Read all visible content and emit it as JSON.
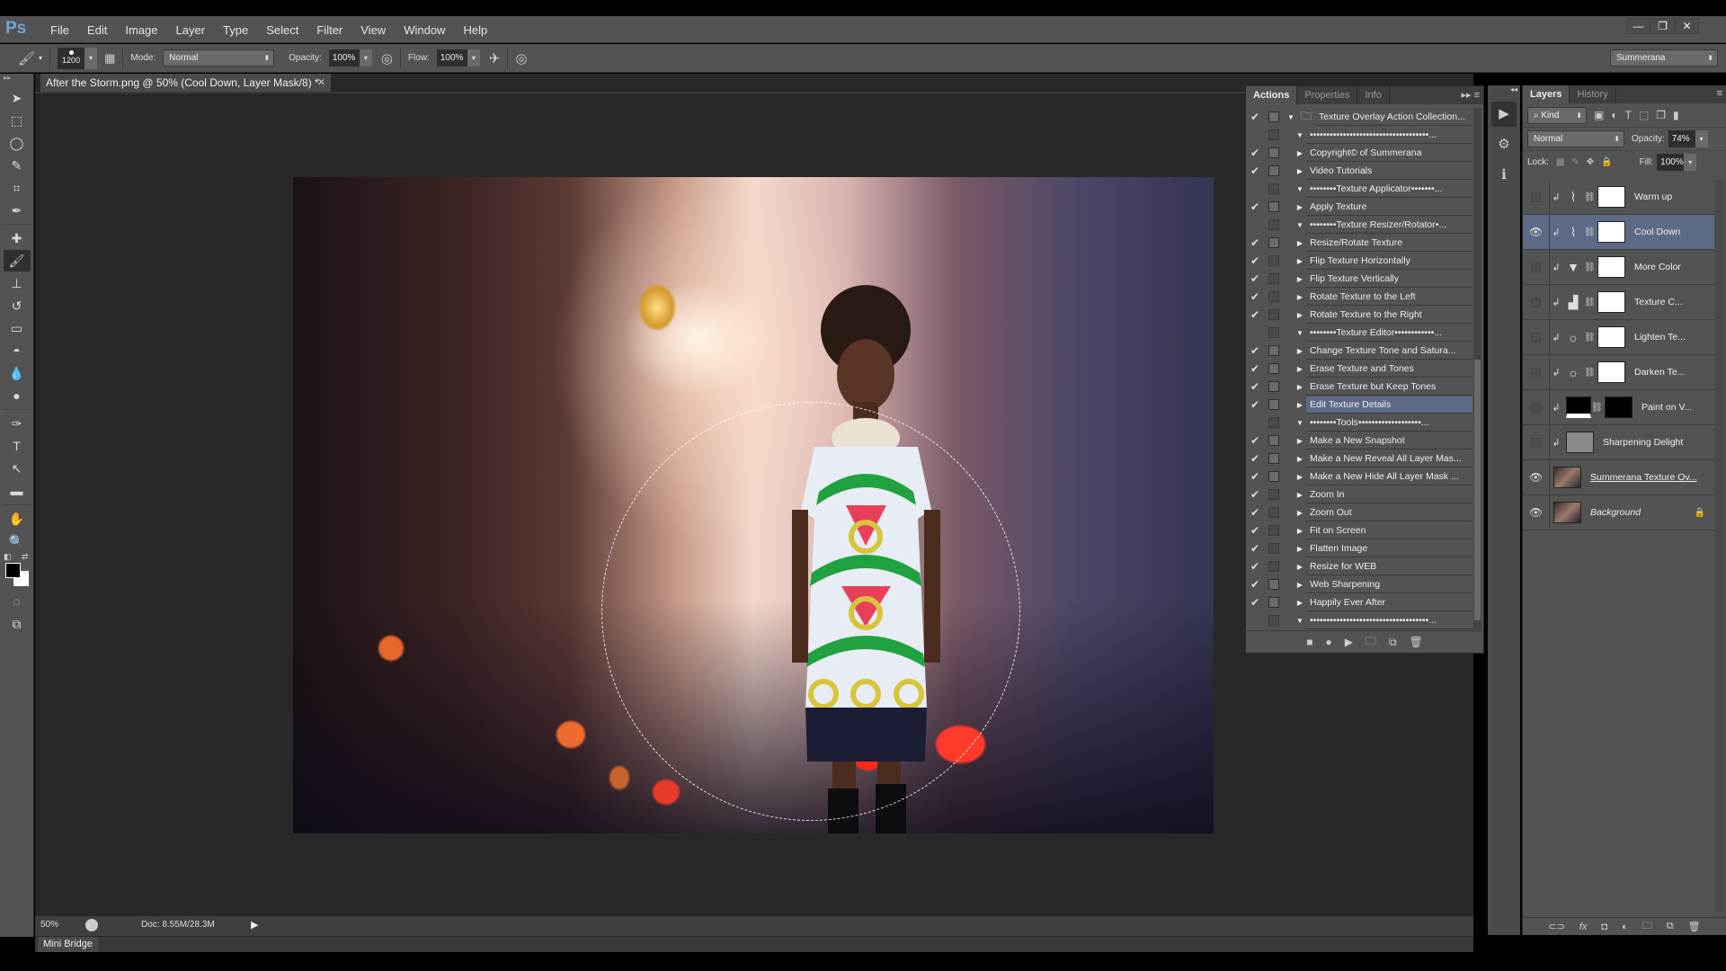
{
  "app": {
    "logo": "Ps"
  },
  "menu": [
    "File",
    "Edit",
    "Image",
    "Layer",
    "Type",
    "Select",
    "Filter",
    "View",
    "Window",
    "Help"
  ],
  "window_controls": {
    "minimize": "—",
    "restore": "❐",
    "close": "✕"
  },
  "options_bar": {
    "brush_size": "1200",
    "mode_label": "Mode:",
    "mode_value": "Normal",
    "opacity_label": "Opacity:",
    "opacity_value": "100%",
    "flow_label": "Flow:",
    "flow_value": "100%",
    "workspace": "Summerana"
  },
  "document": {
    "tab_title": "After the Storm.png @ 50% (Cool Down, Layer Mask/8) *",
    "zoom": "50%",
    "doc_info": "Doc: 8.55M/28.3M"
  },
  "bottom_panel": {
    "mini_bridge": "Mini Bridge"
  },
  "actions_panel": {
    "tabs": [
      "Actions",
      "Properties",
      "Info"
    ],
    "active_tab": "Actions",
    "items": [
      {
        "label": "Texture Overlay Action Collection...",
        "checked": true,
        "dialog": true,
        "expanded": true,
        "level": 0,
        "folder": true
      },
      {
        "label": "••••••••••••••••••••••••••••••••••••...",
        "checked": false,
        "dialog": false,
        "expanded": true,
        "level": 1
      },
      {
        "label": "Copyright© of Summerana",
        "checked": true,
        "dialog": true,
        "expanded": false,
        "level": 1
      },
      {
        "label": "Video Tutorials",
        "checked": true,
        "dialog": true,
        "expanded": false,
        "level": 1
      },
      {
        "label": "••••••••Texture Applicator•••••••...",
        "checked": false,
        "dialog": false,
        "expanded": true,
        "level": 1
      },
      {
        "label": "Apply Texture",
        "checked": true,
        "dialog": true,
        "expanded": false,
        "level": 1
      },
      {
        "label": "••••••••Texture Resizer/Rotator•...",
        "checked": false,
        "dialog": false,
        "expanded": true,
        "level": 1
      },
      {
        "label": "Resize/Rotate Texture",
        "checked": true,
        "dialog": true,
        "expanded": false,
        "level": 1
      },
      {
        "label": "Flip Texture  Horizontally",
        "checked": true,
        "dialog": false,
        "expanded": false,
        "level": 1
      },
      {
        "label": "Flip Texture Vertically",
        "checked": true,
        "dialog": false,
        "expanded": false,
        "level": 1
      },
      {
        "label": "Rotate Texture to the Left",
        "checked": true,
        "dialog": false,
        "expanded": false,
        "level": 1
      },
      {
        "label": "Rotate Texture to the Right",
        "checked": true,
        "dialog": false,
        "expanded": false,
        "level": 1
      },
      {
        "label": "••••••••Texture Editor••••••••••••...",
        "checked": false,
        "dialog": false,
        "expanded": true,
        "level": 1
      },
      {
        "label": "Change Texture Tone and Satura...",
        "checked": true,
        "dialog": true,
        "expanded": false,
        "level": 1
      },
      {
        "label": "Erase Texture and Tones",
        "checked": true,
        "dialog": true,
        "expanded": false,
        "level": 1
      },
      {
        "label": "Erase Texture but Keep Tones",
        "checked": true,
        "dialog": true,
        "expanded": false,
        "level": 1
      },
      {
        "label": "Edit Texture Details",
        "checked": true,
        "dialog": true,
        "expanded": false,
        "level": 1,
        "selected": true
      },
      {
        "label": "••••••••Tools•••••••••••••••••••...",
        "checked": false,
        "dialog": false,
        "expanded": true,
        "level": 1
      },
      {
        "label": "Make a New Snapshot",
        "checked": true,
        "dialog": true,
        "expanded": false,
        "level": 1
      },
      {
        "label": "Make a New Reveal All Layer Mas...",
        "checked": true,
        "dialog": true,
        "expanded": false,
        "level": 1
      },
      {
        "label": "Make a New Hide All Layer Mask ...",
        "checked": true,
        "dialog": true,
        "expanded": false,
        "level": 1
      },
      {
        "label": "Zoom In",
        "checked": true,
        "dialog": false,
        "expanded": false,
        "level": 1
      },
      {
        "label": "Zoom Out",
        "checked": true,
        "dialog": false,
        "expanded": false,
        "level": 1
      },
      {
        "label": "Fit on Screen",
        "checked": true,
        "dialog": false,
        "expanded": false,
        "level": 1
      },
      {
        "label": "Flatten Image",
        "checked": true,
        "dialog": false,
        "expanded": false,
        "level": 1
      },
      {
        "label": "Resize for WEB",
        "checked": true,
        "dialog": false,
        "expanded": false,
        "level": 1
      },
      {
        "label": "Web Sharpening",
        "checked": true,
        "dialog": true,
        "expanded": false,
        "level": 1
      },
      {
        "label": "Happily Ever After",
        "checked": true,
        "dialog": true,
        "expanded": false,
        "level": 1
      },
      {
        "label": "••••••••••••••••••••••••••••••••••••...",
        "checked": false,
        "dialog": false,
        "expanded": true,
        "level": 1
      }
    ],
    "bottom_buttons": [
      "stop",
      "record",
      "play",
      "new-set",
      "new-action",
      "delete"
    ]
  },
  "layers_panel": {
    "tabs": [
      "Layers",
      "History"
    ],
    "active_tab": "Layers",
    "filter": "Kind",
    "blend_mode": "Normal",
    "opacity_label": "Opacity:",
    "opacity_value": "74%",
    "lock_label": "Lock:",
    "fill_label": "Fill:",
    "fill_value": "100%",
    "layers": [
      {
        "name": "Warm up",
        "visible": false,
        "type": "curves",
        "mask": "white",
        "clipped": true
      },
      {
        "name": "Cool Down",
        "visible": true,
        "type": "curves",
        "mask": "white",
        "clipped": true,
        "selected": true
      },
      {
        "name": "More Color",
        "visible": false,
        "type": "gradient-map",
        "mask": "white",
        "clipped": true
      },
      {
        "name": "Texture C...",
        "visible": false,
        "type": "levels",
        "mask": "white",
        "clipped": true
      },
      {
        "name": "Lighten Te...",
        "visible": false,
        "type": "brightness",
        "mask": "white",
        "clipped": true
      },
      {
        "name": "Darken Te...",
        "visible": false,
        "type": "brightness",
        "mask": "white",
        "clipped": true
      },
      {
        "name": "Paint on V...",
        "visible": false,
        "type": "fill-black",
        "mask": "black",
        "clipped": true
      },
      {
        "name": "Sharpening Delight",
        "visible": false,
        "type": "gray-layer",
        "clipped": true
      },
      {
        "name": "Summerana Texture Ov...",
        "visible": true,
        "type": "image",
        "underline": true
      },
      {
        "name": "Background",
        "visible": true,
        "type": "image",
        "italic": true,
        "locked": true
      }
    ]
  },
  "colors": {
    "accent_selection": "#5d6a86",
    "panel_bg": "#535353",
    "canvas_bg": "#282828"
  }
}
